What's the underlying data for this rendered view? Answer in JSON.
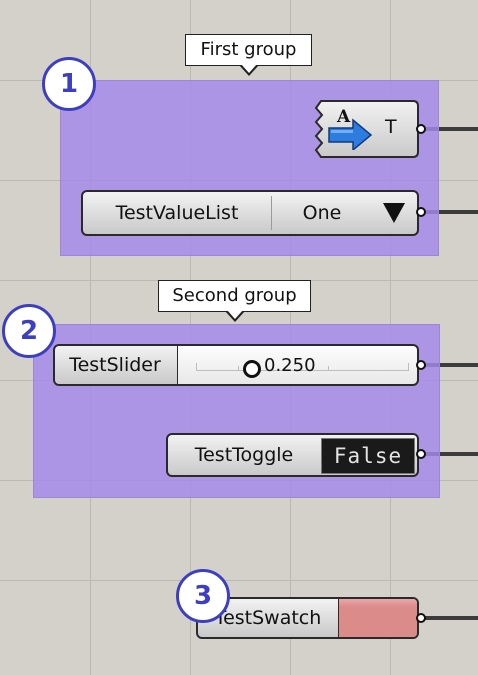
{
  "groups": {
    "first": {
      "label": "First group",
      "marker": "1"
    },
    "second": {
      "label": "Second group",
      "marker": "2"
    },
    "third": {
      "marker": "3"
    }
  },
  "components": {
    "text_panel": {
      "output_label": "T",
      "icon": "text-arrow-icon"
    },
    "value_list": {
      "name": "TestValueList",
      "value": "One",
      "icon": "dropdown-triangle-icon"
    },
    "slider": {
      "name": "TestSlider",
      "value": "0.250",
      "level": 0.25
    },
    "toggle": {
      "name": "TestToggle",
      "value": "False"
    },
    "swatch": {
      "name": "TestSwatch",
      "color": "#dc8b8b"
    }
  },
  "colors": {
    "group_fill": "#a587eb",
    "marker_accent": "#3d3fc1"
  }
}
